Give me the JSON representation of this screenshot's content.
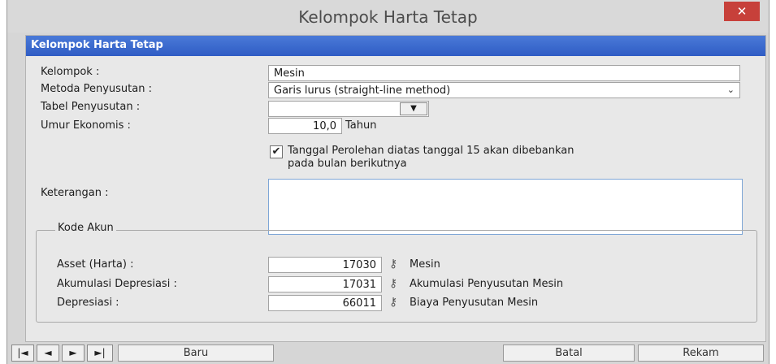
{
  "window": {
    "title": "Kelompok Harta Tetap",
    "close_label": "✕"
  },
  "panel": {
    "header": "Kelompok Harta Tetap"
  },
  "form": {
    "kelompok_label": "Kelompok :",
    "kelompok_value": "Mesin",
    "metoda_label": "Metoda Penyusutan :",
    "metoda_value": "Garis lurus (straight-line method)",
    "tabel_label": "Tabel Penyusutan :",
    "tabel_value": "",
    "umur_label": "Umur Ekonomis :",
    "umur_value": "10,0",
    "umur_unit": "Tahun",
    "checkbox_checked": true,
    "checkbox_line1": "Tanggal Perolehan diatas tanggal 15 akan dibebankan",
    "checkbox_line2": "pada bulan berikutnya",
    "keterangan_label": "Keterangan :",
    "keterangan_value": ""
  },
  "kode_akun": {
    "legend": "Kode Akun",
    "rows": [
      {
        "label": "Asset (Harta) :",
        "code": "17030",
        "name": "Mesin"
      },
      {
        "label": "Akumulasi Depresiasi :",
        "code": "17031",
        "name": "Akumulasi Penyusutan Mesin"
      },
      {
        "label": "Depresiasi :",
        "code": "66011",
        "name": "Biaya Penyusutan Mesin"
      }
    ]
  },
  "navigation": {
    "first_icon": "first-record-icon",
    "prev_icon": "previous-record-icon",
    "next_icon": "next-record-icon",
    "last_icon": "last-record-icon",
    "first": "|◄",
    "prev": "◄",
    "next": "►",
    "last": "►|",
    "baru": "Baru",
    "batal": "Batal",
    "rekam": "Rekam"
  },
  "colors": {
    "header_bar": "#2f5cc4",
    "close_button": "#c7403a"
  }
}
